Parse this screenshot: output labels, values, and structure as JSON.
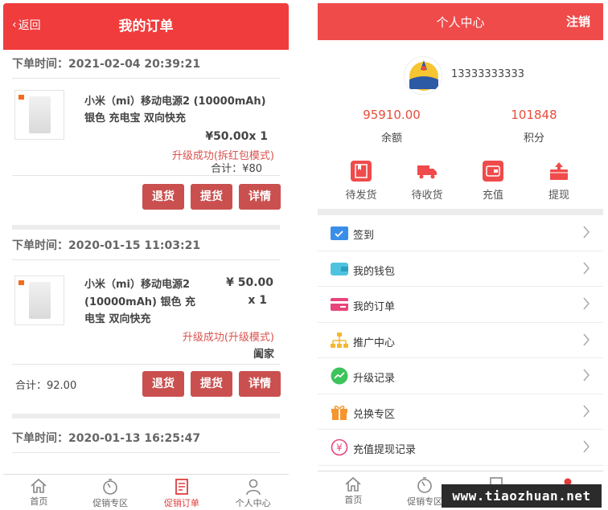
{
  "orders_page": {
    "back_label": "返回",
    "title": "我的订单",
    "orders": [
      {
        "time_label": "下单时间：",
        "time": "2021-02-04 20:39:21",
        "product_line1": "小米（mi）移动电源2 (10000mAh)",
        "product_line2": "银色 充电宝 双向快充",
        "price": "¥50.00x 1",
        "status": "升级成功(拆红包模式)",
        "total": "合计：¥80",
        "buttons": [
          "退货",
          "提货",
          "详情"
        ]
      },
      {
        "time_label": "下单时间：",
        "time": "2020-01-15 11:03:21",
        "product_line1": "小米（mi）移动电源2",
        "product_line2": "(10000mAh) 银色 充",
        "product_line3": "电宝 双向快充",
        "price": "¥ 50.00",
        "qty": "x 1",
        "status": "升级成功(升级模式)",
        "seller": "阖家",
        "total": "合计：92.00",
        "buttons": [
          "退货",
          "提货",
          "详情"
        ]
      },
      {
        "time_label": "下单时间：",
        "time": "2020-01-13 16:25:47"
      }
    ],
    "nav": [
      {
        "label": "首页",
        "icon": "home-icon"
      },
      {
        "label": "促销专区",
        "icon": "timer-icon"
      },
      {
        "label": "促销订单",
        "icon": "order-icon"
      },
      {
        "label": "个人中心",
        "icon": "user-icon"
      }
    ]
  },
  "profile_page": {
    "title": "个人中心",
    "logout": "注销",
    "phone": "13333333333",
    "balance_value": "95910.00",
    "balance_label": "余额",
    "points_value": "101848",
    "points_label": "积分",
    "quick_actions": [
      {
        "label": "待发货",
        "icon": "package-icon"
      },
      {
        "label": "待收货",
        "icon": "truck-icon"
      },
      {
        "label": "充值",
        "icon": "wallet-icon"
      },
      {
        "label": "提现",
        "icon": "withdraw-icon"
      }
    ],
    "menu": [
      {
        "label": "签到",
        "icon": "checkin-icon",
        "color": "#3b8ee8"
      },
      {
        "label": "我的钱包",
        "icon": "wallet-icon",
        "color": "#4ec3e0"
      },
      {
        "label": "我的订单",
        "icon": "card-icon",
        "color": "#e8457a"
      },
      {
        "label": "推广中心",
        "icon": "hierarchy-icon",
        "color": "#f5b731"
      },
      {
        "label": "升级记录",
        "icon": "chart-icon",
        "color": "#3cc35a"
      },
      {
        "label": "兑换专区",
        "icon": "gift-icon",
        "color": "#f5962f"
      },
      {
        "label": "充值提现记录",
        "icon": "yen-icon",
        "color": "#e8457a"
      }
    ],
    "nav": [
      {
        "label": "首页",
        "icon": "home-icon"
      },
      {
        "label": "促销专区",
        "icon": "timer-icon"
      },
      {
        "label": "",
        "icon": "order-icon"
      },
      {
        "label": "",
        "icon": "user-icon"
      }
    ]
  },
  "watermark": "www.tiaozhuan.net",
  "colors": {
    "brand_red": "#f03c3c",
    "button_red": "#c9504f",
    "status_red": "#d9534f"
  }
}
